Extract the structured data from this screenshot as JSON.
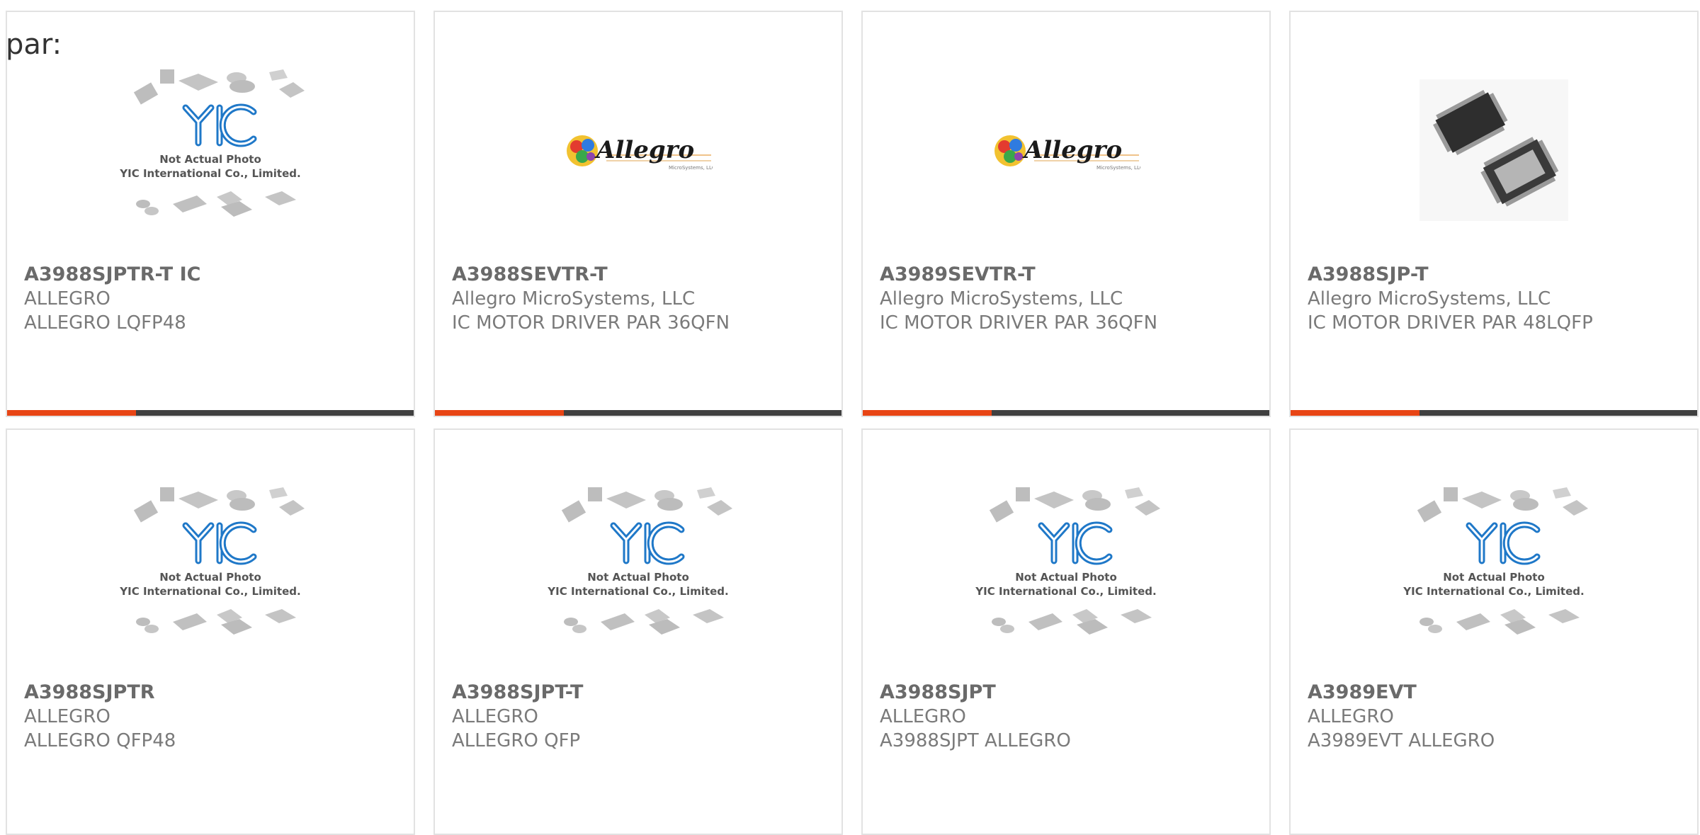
{
  "page": {
    "prefix_label": "par:"
  },
  "placeholder": {
    "line1": "Not Actual Photo",
    "line2": "YIC International Co., Limited."
  },
  "allegro_logo": {
    "wordmark": "Allegro",
    "tagline": "MicroSystems, LLC"
  },
  "colors": {
    "accent": "#e84515",
    "bar_dark": "#404040",
    "logo_blue": "#1f78c8"
  },
  "products": [
    {
      "part": "A3988SJPTR-T IC",
      "manufacturer": "ALLEGRO",
      "description": "ALLEGRO LQFP48",
      "image": "yic-placeholder"
    },
    {
      "part": "A3988SEVTR-T",
      "manufacturer": "Allegro MicroSystems, LLC",
      "description": "IC MOTOR DRIVER PAR 36QFN",
      "image": "allegro-logo"
    },
    {
      "part": "A3989SEVTR-T",
      "manufacturer": "Allegro MicroSystems, LLC",
      "description": "IC MOTOR DRIVER PAR 36QFN",
      "image": "allegro-logo"
    },
    {
      "part": "A3988SJP-T",
      "manufacturer": "Allegro MicroSystems, LLC",
      "description": "IC MOTOR DRIVER PAR 48LQFP",
      "image": "chip-photo"
    },
    {
      "part": "A3988SJPTR",
      "manufacturer": "ALLEGRO",
      "description": "ALLEGRO QFP48",
      "image": "yic-placeholder"
    },
    {
      "part": "A3988SJPT-T",
      "manufacturer": "ALLEGRO",
      "description": "ALLEGRO QFP",
      "image": "yic-placeholder"
    },
    {
      "part": "A3988SJPT",
      "manufacturer": "ALLEGRO",
      "description": "A3988SJPT ALLEGRO",
      "image": "yic-placeholder"
    },
    {
      "part": "A3989EVT",
      "manufacturer": "ALLEGRO",
      "description": "A3989EVT ALLEGRO",
      "image": "yic-placeholder"
    }
  ]
}
